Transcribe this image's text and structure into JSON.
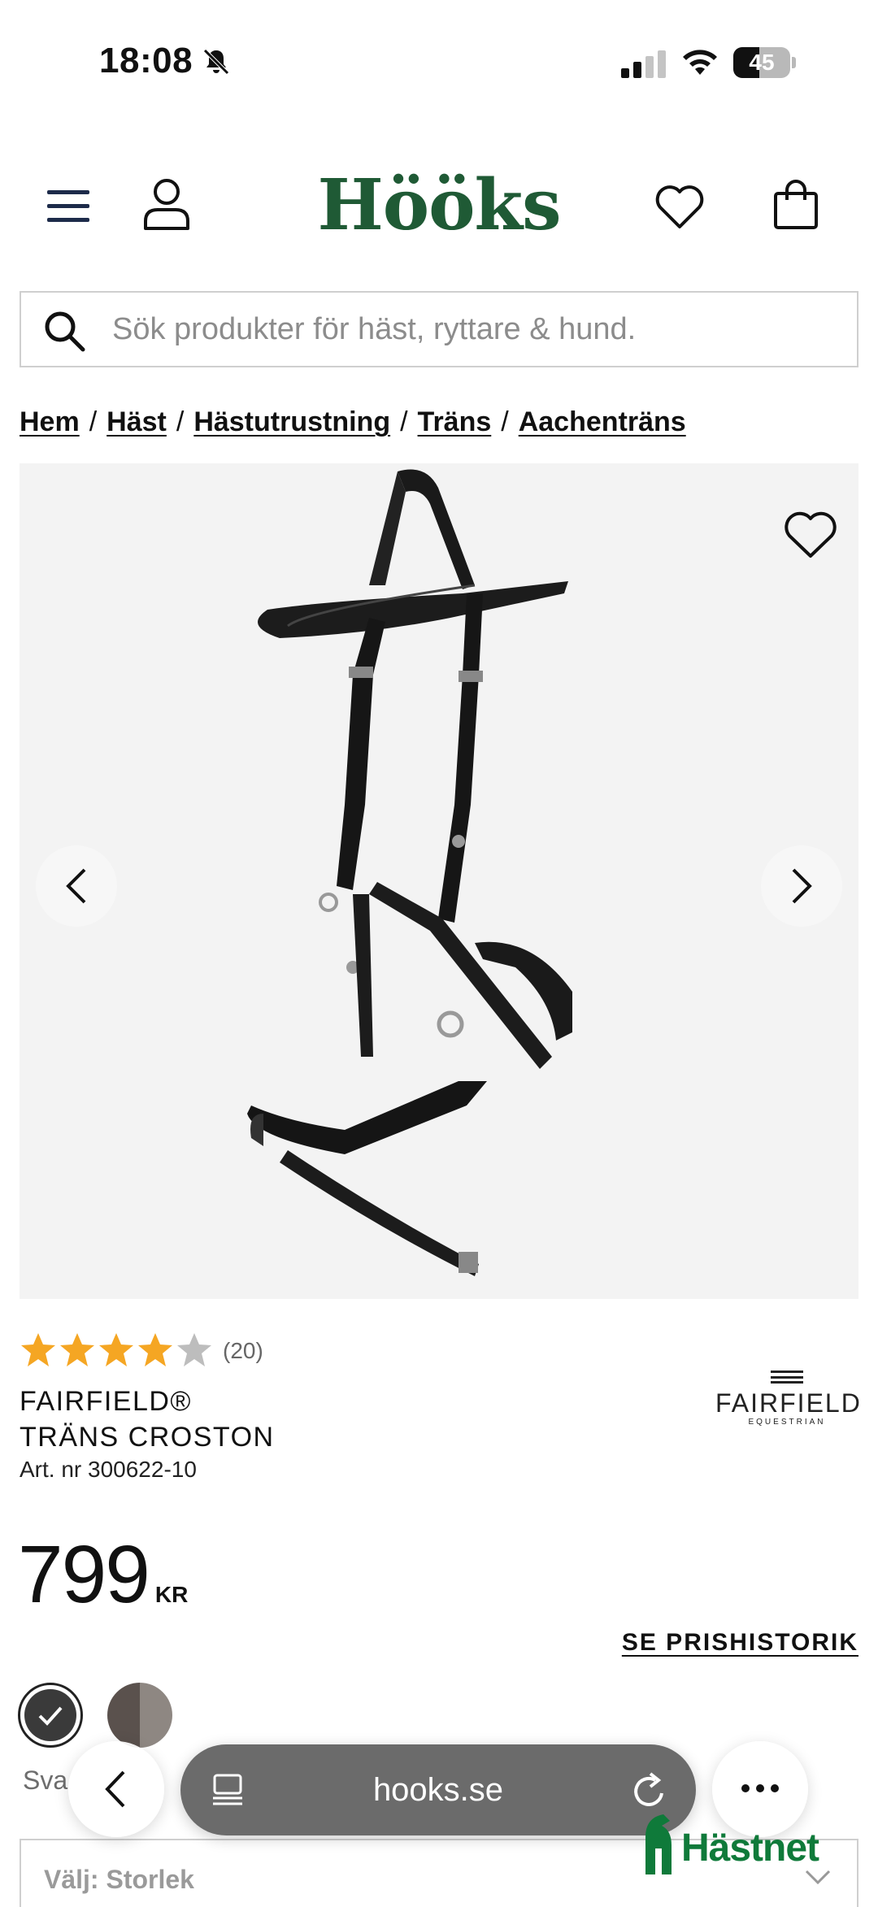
{
  "status_bar": {
    "time": "18:08",
    "battery": "45",
    "battery_level": 0.45
  },
  "header": {
    "logo": "Hööks"
  },
  "search": {
    "placeholder": "Sök produkter för häst, ryttare & hund."
  },
  "breadcrumb": {
    "items": [
      "Hem",
      "Häst",
      "Hästutrustning",
      "Träns",
      "Aachenträns"
    ],
    "separator": "/"
  },
  "product": {
    "rating_value": 4,
    "rating_max": 5,
    "rating_count": "(20)",
    "title_line1": "FAIRFIELD®",
    "title_line2": "TRÄNS CROSTON",
    "art_nr": "Art. nr 300622-10",
    "brand_name": "FAIRFIELD",
    "brand_sub": "EQUESTRIAN",
    "price": "799",
    "currency": "KR",
    "price_history": "SE PRISHISTORIK",
    "color_label": "Sva",
    "size_label": "Välj: Storlek"
  },
  "colors": {
    "brand_green": "#1f5a35",
    "star_filled": "#f5a623",
    "star_empty": "#bdbdbd",
    "hastnet_green": "#0f7a3a"
  },
  "browser": {
    "url": "hooks.se"
  },
  "overlay": {
    "hastnet": "Hästnet"
  }
}
